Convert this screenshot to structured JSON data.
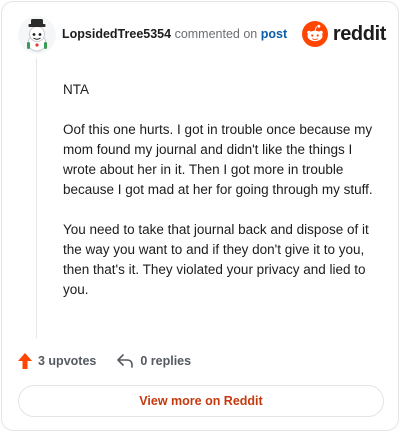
{
  "comment": {
    "username": "LopsidedTree5354",
    "action_text": "commented on",
    "post_link_label": "post",
    "paragraphs": [
      "NTA",
      "Oof this one hurts. I got in trouble once because my mom found my journal and didn't like the things I wrote about her in it. Then I got more in trouble because I got mad at her for going through my stuff.",
      "You need to take that journal back and dispose of it the way you want to and if they don't give it to you, then that's it. They violated your privacy and lied to you."
    ]
  },
  "brand": {
    "name": "reddit",
    "accent_color": "#ff4500",
    "icon": "reddit-snoo-icon"
  },
  "actions": {
    "upvotes_label": "3 upvotes",
    "replies_label": "0 replies",
    "upvote_icon": "upvote-arrow-icon",
    "reply_icon": "reply-arrow-icon",
    "upvote_color": "#ff4500"
  },
  "footer": {
    "view_more_label": "View more on Reddit",
    "view_more_color": "#c43a0e"
  },
  "colors": {
    "link": "#0b5dab",
    "muted_text": "#6b6f73",
    "border": "#e2e4e6"
  }
}
